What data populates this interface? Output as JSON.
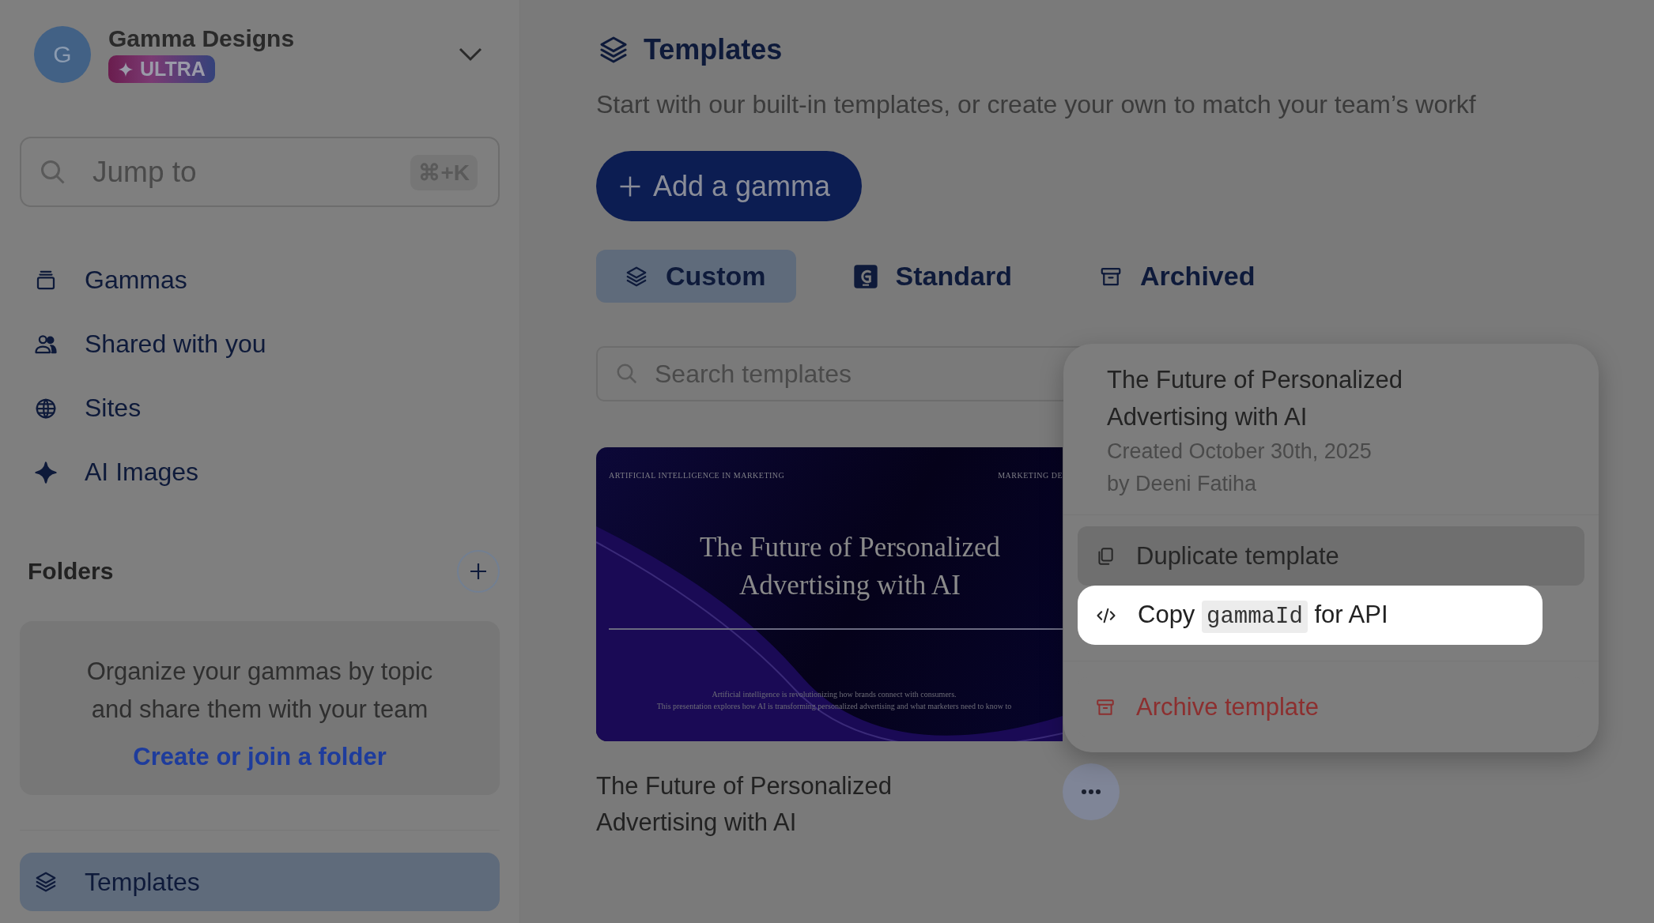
{
  "workspace": {
    "avatar_initial": "G",
    "name": "Gamma Designs",
    "plan_badge": "ULTRA"
  },
  "jump_search": {
    "placeholder": "Jump to",
    "shortcut": "⌘+K"
  },
  "nav": [
    {
      "label": "Gammas",
      "selected": false
    },
    {
      "label": "Shared with you",
      "selected": false
    },
    {
      "label": "Sites",
      "selected": false
    },
    {
      "label": "AI Images",
      "selected": false
    }
  ],
  "folders": {
    "heading": "Folders",
    "empty_message": "Organize your gammas by topic and share them with your team",
    "link": "Create or join a folder"
  },
  "bottom_nav": [
    {
      "label": "Templates",
      "selected": true
    }
  ],
  "page": {
    "title": "Templates",
    "subtitle": "Start with our built-in templates, or create your own to match your team’s workf"
  },
  "add_button": "Add a gamma",
  "tabs": [
    {
      "label": "Custom",
      "selected": true
    },
    {
      "label": "Standard",
      "selected": false
    },
    {
      "label": "Archived",
      "selected": false
    }
  ],
  "search": {
    "placeholder": "Search templates"
  },
  "templates": [
    {
      "title": "The Future of Personalized Advertising with AI",
      "thumbnail": {
        "eyebrow": "ARTIFICIAL INTELLIGENCE IN MARKETING",
        "corner": "MARKETING DE",
        "heading": "The Future of Personalized Advertising with AI",
        "lines": [
          "Artificial intelligence is revolutionizing how brands connect with consumers.",
          "This presentation explores how AI is transforming personalized advertising and what marketers need to know to"
        ]
      }
    }
  ],
  "context_menu": {
    "title": "The Future of Personalized Advertising with AI",
    "created": "Created October 30th, 2025",
    "author": "by Deeni Fatiha",
    "items": [
      {
        "kind": "normal",
        "label": "Duplicate template",
        "hovered": true,
        "selected": false
      },
      {
        "kind": "code",
        "before": "Copy",
        "code": "gammaId",
        "after": "for API",
        "hovered": false,
        "selected": true
      },
      {
        "kind": "danger",
        "label": "Archive template",
        "hovered": false,
        "selected": false
      }
    ]
  }
}
